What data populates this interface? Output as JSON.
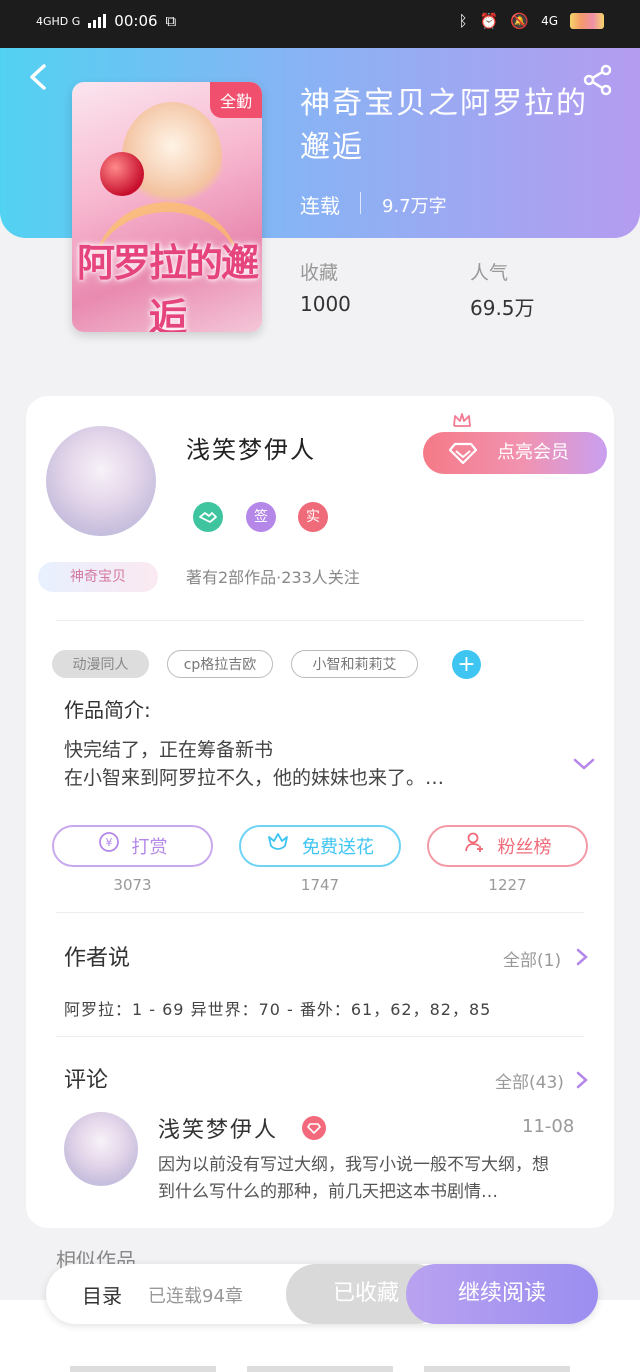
{
  "status_bar": {
    "network": "4GHD G",
    "time": "00:06",
    "right_net": "4G"
  },
  "book": {
    "title": "神奇宝贝之阿罗拉的邂逅",
    "cover_tag": "全勤",
    "cover_title": "阿罗拉的邂逅",
    "status": "连载",
    "words": "9.7万字",
    "collect_label": "收藏",
    "collect_value": "1000",
    "popularity_label": "人气",
    "popularity_value": "69.5万"
  },
  "author": {
    "name": "浅笑梦伊人",
    "avatar_tag": "神奇宝贝",
    "vip_button": "点亮会员",
    "badges": [
      {
        "label": "",
        "color": "#3fc4a0"
      },
      {
        "label": "签",
        "color": "#b487e8"
      },
      {
        "label": "实",
        "color": "#f06b7a"
      }
    ],
    "meta": "著有2部作品·233人关注"
  },
  "tags": [
    "动漫同人",
    "cp格拉吉欧",
    "小智和莉莉艾"
  ],
  "intro": {
    "title": "作品简介:",
    "line1": "快完结了，正在筹备新书",
    "line2": "在小智来到阿罗拉不久，他的妹妹也来了。…"
  },
  "actions": [
    {
      "label": "打赏",
      "count": "3073",
      "color": "#b487e8"
    },
    {
      "label": "免费送花",
      "count": "1747",
      "color": "#3fc5f2"
    },
    {
      "label": "粉丝榜",
      "count": "1227",
      "color": "#f06b7a"
    }
  ],
  "author_said": {
    "title": "作者说",
    "more": "全部(1)",
    "text": "阿罗拉：1 - 69 异世界：70 - 番外：61，62，82，85"
  },
  "comments": {
    "title": "评论",
    "more": "全部(43)",
    "item": {
      "name": "浅笑梦伊人",
      "date": "11-08",
      "text": "因为以前没有写过大纲，我写小说一般不写大纲，想到什么写什么的那种，前几天把这本书剧情…"
    }
  },
  "similar": "相似作品",
  "bottom": {
    "toc": "目录",
    "toc_sub": "已连载94章",
    "fav": "已收藏",
    "read": "继续阅读"
  }
}
